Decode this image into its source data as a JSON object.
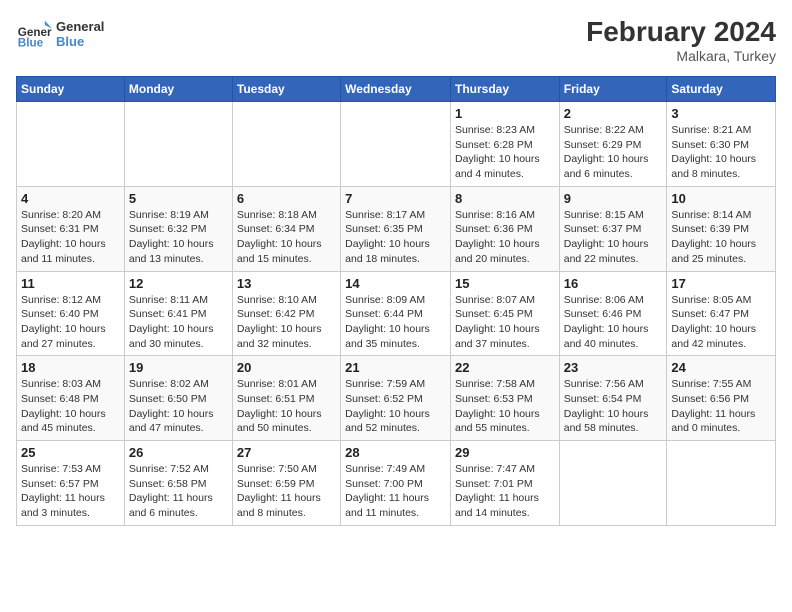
{
  "header": {
    "logo_general": "General",
    "logo_blue": "Blue",
    "main_title": "February 2024",
    "subtitle": "Malkara, Turkey"
  },
  "days_of_week": [
    "Sunday",
    "Monday",
    "Tuesday",
    "Wednesday",
    "Thursday",
    "Friday",
    "Saturday"
  ],
  "weeks": [
    [
      {
        "day": "",
        "info": ""
      },
      {
        "day": "",
        "info": ""
      },
      {
        "day": "",
        "info": ""
      },
      {
        "day": "",
        "info": ""
      },
      {
        "day": "1",
        "info": "Sunrise: 8:23 AM\nSunset: 6:28 PM\nDaylight: 10 hours\nand 4 minutes."
      },
      {
        "day": "2",
        "info": "Sunrise: 8:22 AM\nSunset: 6:29 PM\nDaylight: 10 hours\nand 6 minutes."
      },
      {
        "day": "3",
        "info": "Sunrise: 8:21 AM\nSunset: 6:30 PM\nDaylight: 10 hours\nand 8 minutes."
      }
    ],
    [
      {
        "day": "4",
        "info": "Sunrise: 8:20 AM\nSunset: 6:31 PM\nDaylight: 10 hours\nand 11 minutes."
      },
      {
        "day": "5",
        "info": "Sunrise: 8:19 AM\nSunset: 6:32 PM\nDaylight: 10 hours\nand 13 minutes."
      },
      {
        "day": "6",
        "info": "Sunrise: 8:18 AM\nSunset: 6:34 PM\nDaylight: 10 hours\nand 15 minutes."
      },
      {
        "day": "7",
        "info": "Sunrise: 8:17 AM\nSunset: 6:35 PM\nDaylight: 10 hours\nand 18 minutes."
      },
      {
        "day": "8",
        "info": "Sunrise: 8:16 AM\nSunset: 6:36 PM\nDaylight: 10 hours\nand 20 minutes."
      },
      {
        "day": "9",
        "info": "Sunrise: 8:15 AM\nSunset: 6:37 PM\nDaylight: 10 hours\nand 22 minutes."
      },
      {
        "day": "10",
        "info": "Sunrise: 8:14 AM\nSunset: 6:39 PM\nDaylight: 10 hours\nand 25 minutes."
      }
    ],
    [
      {
        "day": "11",
        "info": "Sunrise: 8:12 AM\nSunset: 6:40 PM\nDaylight: 10 hours\nand 27 minutes."
      },
      {
        "day": "12",
        "info": "Sunrise: 8:11 AM\nSunset: 6:41 PM\nDaylight: 10 hours\nand 30 minutes."
      },
      {
        "day": "13",
        "info": "Sunrise: 8:10 AM\nSunset: 6:42 PM\nDaylight: 10 hours\nand 32 minutes."
      },
      {
        "day": "14",
        "info": "Sunrise: 8:09 AM\nSunset: 6:44 PM\nDaylight: 10 hours\nand 35 minutes."
      },
      {
        "day": "15",
        "info": "Sunrise: 8:07 AM\nSunset: 6:45 PM\nDaylight: 10 hours\nand 37 minutes."
      },
      {
        "day": "16",
        "info": "Sunrise: 8:06 AM\nSunset: 6:46 PM\nDaylight: 10 hours\nand 40 minutes."
      },
      {
        "day": "17",
        "info": "Sunrise: 8:05 AM\nSunset: 6:47 PM\nDaylight: 10 hours\nand 42 minutes."
      }
    ],
    [
      {
        "day": "18",
        "info": "Sunrise: 8:03 AM\nSunset: 6:48 PM\nDaylight: 10 hours\nand 45 minutes."
      },
      {
        "day": "19",
        "info": "Sunrise: 8:02 AM\nSunset: 6:50 PM\nDaylight: 10 hours\nand 47 minutes."
      },
      {
        "day": "20",
        "info": "Sunrise: 8:01 AM\nSunset: 6:51 PM\nDaylight: 10 hours\nand 50 minutes."
      },
      {
        "day": "21",
        "info": "Sunrise: 7:59 AM\nSunset: 6:52 PM\nDaylight: 10 hours\nand 52 minutes."
      },
      {
        "day": "22",
        "info": "Sunrise: 7:58 AM\nSunset: 6:53 PM\nDaylight: 10 hours\nand 55 minutes."
      },
      {
        "day": "23",
        "info": "Sunrise: 7:56 AM\nSunset: 6:54 PM\nDaylight: 10 hours\nand 58 minutes."
      },
      {
        "day": "24",
        "info": "Sunrise: 7:55 AM\nSunset: 6:56 PM\nDaylight: 11 hours\nand 0 minutes."
      }
    ],
    [
      {
        "day": "25",
        "info": "Sunrise: 7:53 AM\nSunset: 6:57 PM\nDaylight: 11 hours\nand 3 minutes."
      },
      {
        "day": "26",
        "info": "Sunrise: 7:52 AM\nSunset: 6:58 PM\nDaylight: 11 hours\nand 6 minutes."
      },
      {
        "day": "27",
        "info": "Sunrise: 7:50 AM\nSunset: 6:59 PM\nDaylight: 11 hours\nand 8 minutes."
      },
      {
        "day": "28",
        "info": "Sunrise: 7:49 AM\nSunset: 7:00 PM\nDaylight: 11 hours\nand 11 minutes."
      },
      {
        "day": "29",
        "info": "Sunrise: 7:47 AM\nSunset: 7:01 PM\nDaylight: 11 hours\nand 14 minutes."
      },
      {
        "day": "",
        "info": ""
      },
      {
        "day": "",
        "info": ""
      }
    ]
  ]
}
